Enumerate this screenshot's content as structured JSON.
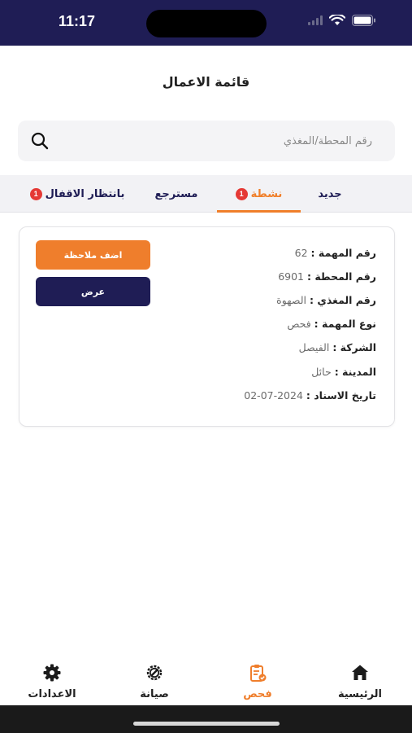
{
  "status_bar": {
    "time": "11:17",
    "icons": [
      "signal-icon",
      "wifi-icon",
      "battery-icon"
    ]
  },
  "header": {
    "title": "قائمة الاعمال"
  },
  "search": {
    "placeholder": "رقم المحطة/المغذي",
    "value": "",
    "icon": "search-icon"
  },
  "tabs": [
    {
      "label": "جديد",
      "badge": "",
      "active": false
    },
    {
      "label": "نشطة",
      "badge": "1",
      "active": true
    },
    {
      "label": "مسترجع",
      "badge": "",
      "active": false
    },
    {
      "label": "بانتظار الاقفال",
      "badge": "1",
      "active": false
    }
  ],
  "card": {
    "fields": [
      {
        "label": "رقم المهمة :",
        "value": "62"
      },
      {
        "label": "رقم المحطة :",
        "value": "6901"
      },
      {
        "label": "رقم المغذي :",
        "value": "الصهوة"
      },
      {
        "label": "نوع المهمة :",
        "value": "فحص"
      },
      {
        "label": "الشركة :",
        "value": "الفيصل"
      },
      {
        "label": "المدينة :",
        "value": "حائل"
      },
      {
        "label": "تاريخ الاسناد :",
        "value": "2024-07-02"
      }
    ],
    "add_note_label": "اضف ملاحظة",
    "view_label": "عرض"
  },
  "bottom_nav": [
    {
      "label": "الرئيسية",
      "icon": "home-icon",
      "active": false
    },
    {
      "label": "فحص",
      "icon": "inspection-clipboard-icon",
      "active": true
    },
    {
      "label": "صيانة",
      "icon": "maintenance-wrench-icon",
      "active": false
    },
    {
      "label": "الاعدادات",
      "icon": "settings-gear-icon",
      "active": false
    }
  ],
  "colors": {
    "primary_navy": "#1f1d55",
    "accent_orange": "#ef7e2c",
    "badge_red": "#e53935"
  }
}
